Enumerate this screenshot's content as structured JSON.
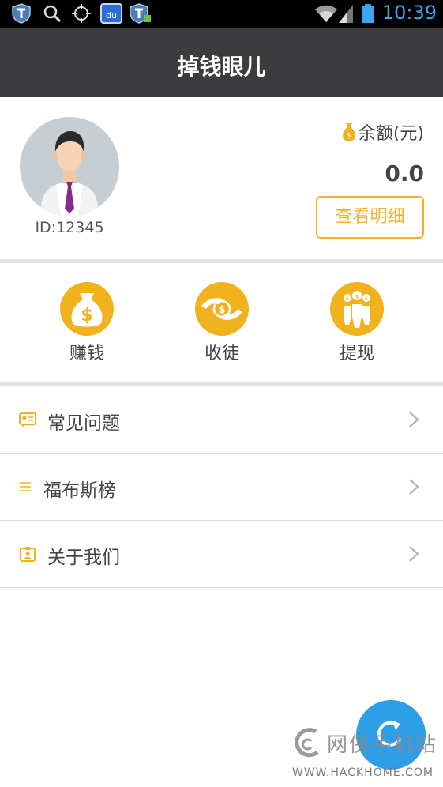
{
  "status_bar": {
    "time": "10:39",
    "icons": [
      "shield-icon",
      "search-icon",
      "locate-icon",
      "baidu-icon",
      "shield-app-icon",
      "wifi-icon",
      "signal-icon",
      "battery-icon"
    ],
    "baidu_text": "du"
  },
  "header": {
    "title": "掉钱眼儿"
  },
  "profile": {
    "id_label": "ID:12345",
    "balance_label": "余额(元)",
    "balance_value": "0.0",
    "detail_button": "查看明细"
  },
  "actions": [
    {
      "label": "赚钱",
      "icon": "money-bag-icon"
    },
    {
      "label": "收徒",
      "icon": "hands-coin-icon"
    },
    {
      "label": "提现",
      "icon": "people-coins-icon"
    }
  ],
  "menu": [
    {
      "label": "常见问题",
      "icon": "faq-card-icon"
    },
    {
      "label": "福布斯榜",
      "icon": "list-icon"
    },
    {
      "label": "关于我们",
      "icon": "about-badge-icon"
    }
  ],
  "watermark": {
    "title": "网侠手机站",
    "url": "WWW.HACKHOME.COM"
  },
  "colors": {
    "accent": "#f1b21d",
    "header_bg": "#3c3c3e",
    "fab": "#2d9ee8",
    "time": "#3aa8f0"
  }
}
